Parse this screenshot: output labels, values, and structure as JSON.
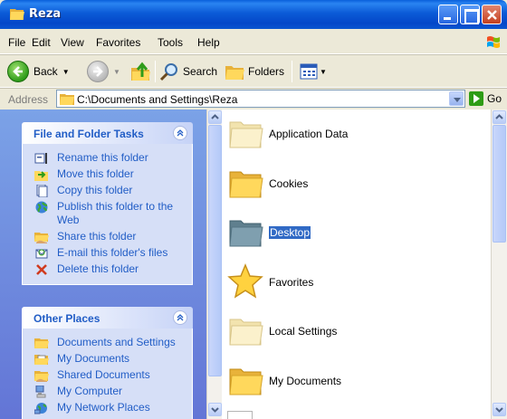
{
  "window": {
    "title": "Reza"
  },
  "menu": {
    "items": [
      "File",
      "Edit",
      "View",
      "Favorites",
      "Tools",
      "Help"
    ]
  },
  "toolbar": {
    "back_label": "Back",
    "search_label": "Search",
    "folders_label": "Folders"
  },
  "address": {
    "label": "Address",
    "value": "C:\\Documents and Settings\\Reza",
    "go_label": "Go"
  },
  "tasks_panel": {
    "title": "File and Folder Tasks",
    "items": [
      {
        "label": "Rename this folder",
        "icon": "rename-icon"
      },
      {
        "label": "Move this folder",
        "icon": "move-icon"
      },
      {
        "label": "Copy this folder",
        "icon": "copy-icon"
      },
      {
        "label": "Publish this folder to the Web",
        "icon": "globe-icon"
      },
      {
        "label": "Share this folder",
        "icon": "share-icon"
      },
      {
        "label": "E-mail this folder's files",
        "icon": "email-icon"
      },
      {
        "label": "Delete this folder",
        "icon": "delete-icon"
      }
    ]
  },
  "places_panel": {
    "title": "Other Places",
    "items": [
      {
        "label": "Documents and Settings",
        "icon": "folder-icon"
      },
      {
        "label": "My Documents",
        "icon": "my-documents-icon"
      },
      {
        "label": "Shared Documents",
        "icon": "shared-folder-icon"
      },
      {
        "label": "My Computer",
        "icon": "computer-icon"
      },
      {
        "label": "My Network Places",
        "icon": "network-icon"
      }
    ]
  },
  "files": [
    {
      "name": "Application Data",
      "icon": "folder-faded-icon",
      "selected": false
    },
    {
      "name": "Cookies",
      "icon": "folder-icon",
      "selected": false
    },
    {
      "name": "Desktop",
      "icon": "folder-selected-icon",
      "selected": true
    },
    {
      "name": "Favorites",
      "icon": "star-icon",
      "selected": false
    },
    {
      "name": "Local Settings",
      "icon": "folder-faded-icon",
      "selected": false
    },
    {
      "name": "My Documents",
      "icon": "folder-icon",
      "selected": false
    }
  ],
  "colors": {
    "titlebar": "#0b5bd7",
    "taskpane": "#7ba2e7",
    "link": "#215dc6",
    "selection": "#316ac5"
  }
}
